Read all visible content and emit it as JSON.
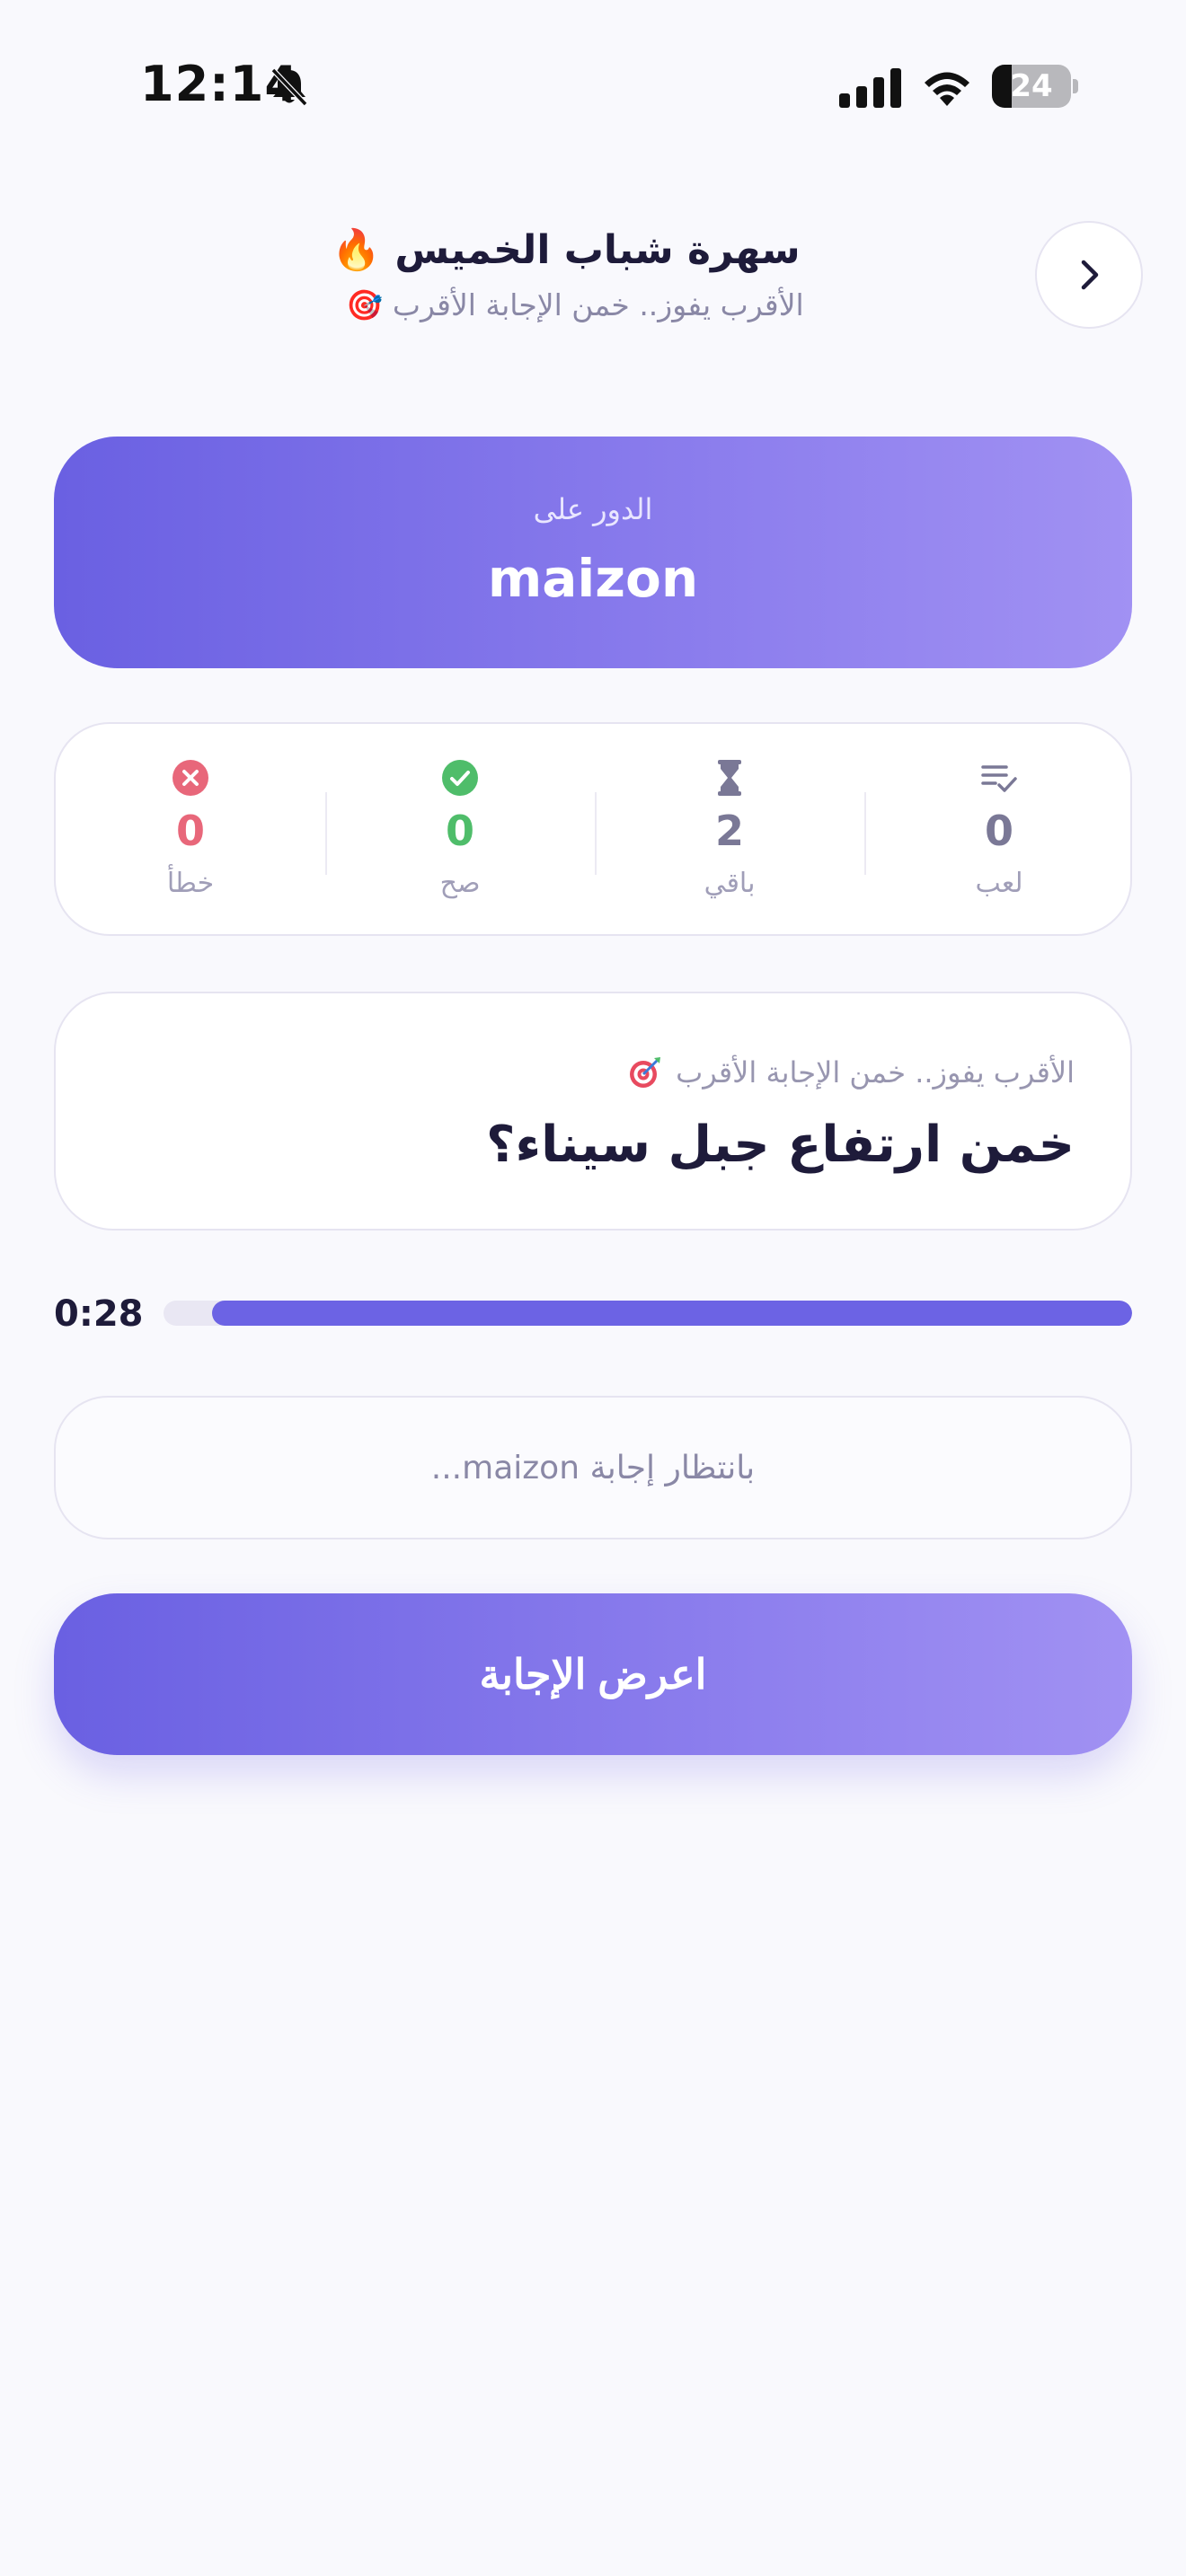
{
  "status_bar": {
    "time": "12:14",
    "battery": "24",
    "icons": [
      "bell-slash-icon",
      "cellular-signal-icon",
      "wifi-icon",
      "battery-icon"
    ]
  },
  "header": {
    "title": "سهرة شباب الخميس 🔥",
    "subtitle": "الأقرب يفوز.. خمن الإجابة الأقرب 🎯",
    "back_icon": "chevron-right-icon"
  },
  "turn": {
    "label": "الدور على",
    "player": "maizon"
  },
  "stats": {
    "wrong": {
      "value": "0",
      "label": "خطأ",
      "icon": "x-circle-icon",
      "color": "#e8677a"
    },
    "correct": {
      "value": "0",
      "label": "صح",
      "icon": "check-circle-icon",
      "color": "#4fbd6a"
    },
    "remaining": {
      "value": "2",
      "label": "باقي",
      "icon": "hourglass-icon",
      "color": "#7a7896"
    },
    "played": {
      "value": "0",
      "label": "لعب",
      "icon": "list-check-icon",
      "color": "#7a7896"
    }
  },
  "question": {
    "hint": "الأقرب يفوز.. خمن الإجابة الأقرب",
    "hint_icon": "target-icon",
    "text": "خمن ارتفاع جبل سيناء؟"
  },
  "timer": {
    "text": "0:28",
    "progress_fraction": 0.95
  },
  "waiting": {
    "text": "بانتظار إجابة maizon..."
  },
  "reveal_button": {
    "label": "اعرض الإجابة"
  },
  "colors": {
    "accent": "#6c63e4",
    "accent_light": "#a191f3",
    "background": "#f9f9fd"
  }
}
